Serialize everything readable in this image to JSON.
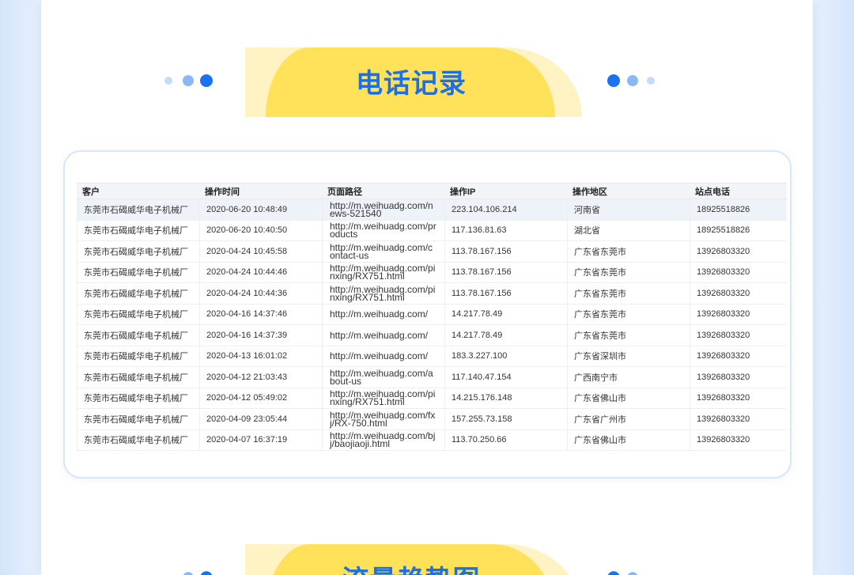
{
  "colors": {
    "accent": "#1b6fe8",
    "banner_yellow": "#ffe15a",
    "banner_pale": "#fff3c4",
    "dot_strong": "#1a72f0",
    "dot_mid": "#8bb8f4",
    "dot_light": "#c4dbfa"
  },
  "phone_section": {
    "title": "电话记录",
    "table": {
      "columns": [
        "客户",
        "操作时间",
        "页面路径",
        "操作IP",
        "操作地区",
        "站点电话"
      ],
      "rows": [
        {
          "customer": "东莞市石碣威华电子机械厂",
          "time": "2020-06-20 10:48:49",
          "path": "http://m.weihuadg.com/news-521540",
          "ip": "223.104.106.214",
          "region": "河南省",
          "phone": "18925518826"
        },
        {
          "customer": "东莞市石碣威华电子机械厂",
          "time": "2020-06-20 10:40:50",
          "path": "http://m.weihuadg.com/products",
          "ip": "117.136.81.63",
          "region": "湖北省",
          "phone": "18925518826"
        },
        {
          "customer": "东莞市石碣威华电子机械厂",
          "time": "2020-04-24 10:45:58",
          "path": "http://m.weihuadg.com/contact-us",
          "ip": "113.78.167.156",
          "region": "广东省东莞市",
          "phone": "13926803320"
        },
        {
          "customer": "东莞市石碣威华电子机械厂",
          "time": "2020-04-24 10:44:46",
          "path": "http://m.weihuadg.com/pinxing/RX751.html",
          "ip": "113.78.167.156",
          "region": "广东省东莞市",
          "phone": "13926803320"
        },
        {
          "customer": "东莞市石碣威华电子机械厂",
          "time": "2020-04-24 10:44:36",
          "path": "http://m.weihuadg.com/pinxing/RX751.html",
          "ip": "113.78.167.156",
          "region": "广东省东莞市",
          "phone": "13926803320"
        },
        {
          "customer": "东莞市石碣威华电子机械厂",
          "time": "2020-04-16 14:37:46",
          "path": "http://m.weihuadg.com/",
          "ip": "14.217.78.49",
          "region": "广东省东莞市",
          "phone": "13926803320"
        },
        {
          "customer": "东莞市石碣威华电子机械厂",
          "time": "2020-04-16 14:37:39",
          "path": "http://m.weihuadg.com/",
          "ip": "14.217.78.49",
          "region": "广东省东莞市",
          "phone": "13926803320"
        },
        {
          "customer": "东莞市石碣威华电子机械厂",
          "time": "2020-04-13 16:01:02",
          "path": "http://m.weihuadg.com/",
          "ip": "183.3.227.100",
          "region": "广东省深圳市",
          "phone": "13926803320"
        },
        {
          "customer": "东莞市石碣威华电子机械厂",
          "time": "2020-04-12 21:03:43",
          "path": "http://m.weihuadg.com/about-us",
          "ip": "117.140.47.154",
          "region": "广西南宁市",
          "phone": "13926803320"
        },
        {
          "customer": "东莞市石碣威华电子机械厂",
          "time": "2020-04-12 05:49:02",
          "path": "http://m.weihuadg.com/pinxing/RX751.html",
          "ip": "14.215.176.148",
          "region": "广东省佛山市",
          "phone": "13926803320"
        },
        {
          "customer": "东莞市石碣威华电子机械厂",
          "time": "2020-04-09 23:05:44",
          "path": "http://m.weihuadg.com/fxj/RX-750.html",
          "ip": "157.255.73.158",
          "region": "广东省广州市",
          "phone": "13926803320"
        },
        {
          "customer": "东莞市石碣威华电子机械厂",
          "time": "2020-04-07 16:37:19",
          "path": "http://m.weihuadg.com/bjj/baojiaoji.html",
          "ip": "113.70.250.66",
          "region": "广东省佛山市",
          "phone": "13926803320"
        }
      ]
    }
  },
  "traffic_section": {
    "title": "流量趋势图"
  }
}
